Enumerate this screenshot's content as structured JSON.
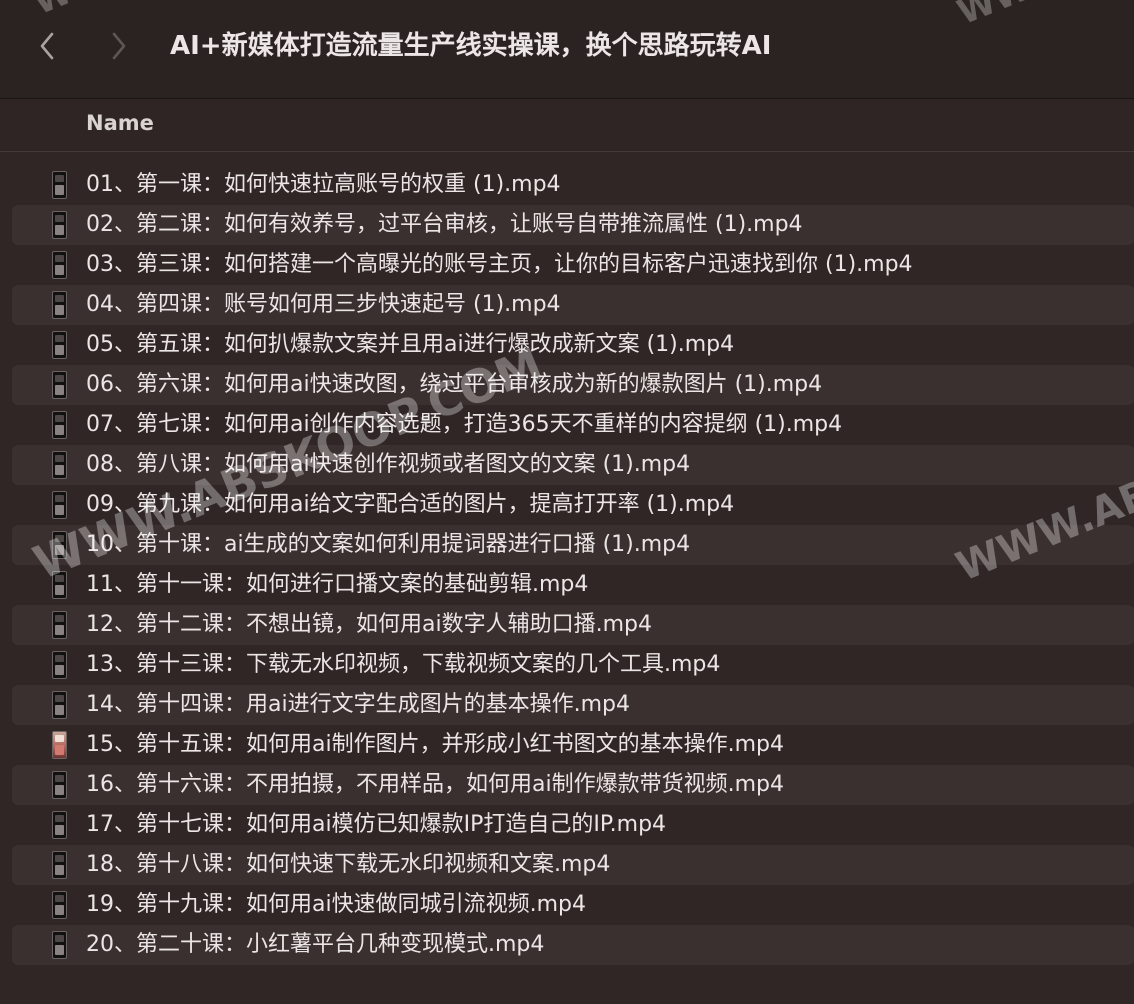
{
  "window": {
    "title": "AI+新媒体打造流量生产线实操课，换个思路玩转AI"
  },
  "toolbar": {
    "back_icon": "chevron-left-icon",
    "forward_icon": "chevron-right-icon"
  },
  "list_header": {
    "name_label": "Name"
  },
  "files": [
    {
      "name": "01、第一课：如何快速拉高账号的权重 (1).mp4",
      "icon": "video-file-icon"
    },
    {
      "name": "02、第二课：如何有效养号，过平台审核，让账号自带推流属性 (1).mp4",
      "icon": "video-file-icon"
    },
    {
      "name": "03、第三课：如何搭建一个高曝光的账号主页，让你的目标客户迅速找到你 (1).mp4",
      "icon": "video-file-icon"
    },
    {
      "name": "04、第四课：账号如何用三步快速起号 (1).mp4",
      "icon": "video-file-icon"
    },
    {
      "name": "05、第五课：如何扒爆款文案并且用ai进行爆改成新文案 (1).mp4",
      "icon": "video-file-icon"
    },
    {
      "name": "06、第六课：如何用ai快速改图，绕过平台审核成为新的爆款图片 (1).mp4",
      "icon": "video-file-icon"
    },
    {
      "name": "07、第七课：如何用ai创作内容选题，打造365天不重样的内容提纲 (1).mp4",
      "icon": "video-file-icon"
    },
    {
      "name": "08、第八课：如何用ai快速创作视频或者图文的文案 (1).mp4",
      "icon": "video-file-icon"
    },
    {
      "name": "09、第九课：如何用ai给文字配合适的图片，提高打开率 (1).mp4",
      "icon": "video-file-icon"
    },
    {
      "name": "10、第十课：ai生成的文案如何利用提词器进行口播 (1).mp4",
      "icon": "video-file-icon"
    },
    {
      "name": "11、第十一课：如何进行口播文案的基础剪辑.mp4",
      "icon": "video-file-icon"
    },
    {
      "name": "12、第十二课：不想出镜，如何用ai数字人辅助口播.mp4",
      "icon": "video-file-icon"
    },
    {
      "name": "13、第十三课：下载无水印视频，下载视频文案的几个工具.mp4",
      "icon": "video-file-icon"
    },
    {
      "name": "14、第十四课：用ai进行文字生成图片的基本操作.mp4",
      "icon": "video-file-icon"
    },
    {
      "name": "15、第十五课：如何用ai制作图片，并形成小红书图文的基本操作.mp4",
      "icon": "video-thumbnail-icon"
    },
    {
      "name": "16、第十六课：不用拍摄，不用样品，如何用ai制作爆款带货视频.mp4",
      "icon": "video-file-icon"
    },
    {
      "name": "17、第十七课：如何用ai模仿已知爆款IP打造自己的IP.mp4",
      "icon": "video-file-icon"
    },
    {
      "name": "18、第十八课：如何快速下载无水印视频和文案.mp4",
      "icon": "video-file-icon"
    },
    {
      "name": "19、第十九课：如何用ai快速做同城引流视频.mp4",
      "icon": "video-file-icon"
    },
    {
      "name": "20、第二十课：小红薯平台几种变现模式.mp4",
      "icon": "video-file-icon"
    }
  ],
  "watermarks": {
    "top_left": "WWW",
    "top_right": "WWW",
    "center": "WWW.ABSKOOP.COM",
    "right": "WWW.AB"
  }
}
